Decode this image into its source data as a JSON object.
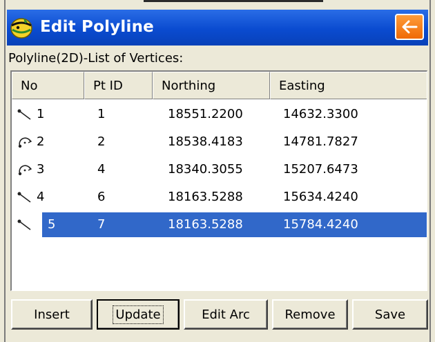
{
  "window": {
    "title": "Edit Polyline",
    "back_icon": "back-arrow-icon",
    "accent": "#0a4bd0",
    "back_color": "#ef6a05"
  },
  "list": {
    "caption": "Polyline(2D)-List of Vertices:",
    "columns": [
      "No",
      "Pt ID",
      "Northing",
      "Easting"
    ],
    "rows": [
      {
        "icon": "line-segment-icon",
        "no": "1",
        "pt_id": "1",
        "northing": "18551.2200",
        "easting": "14632.3300",
        "selected": false
      },
      {
        "icon": "arc-segment-icon",
        "no": "2",
        "pt_id": "2",
        "northing": "18538.4183",
        "easting": "14781.7827",
        "selected": false
      },
      {
        "icon": "arc-segment-icon",
        "no": "3",
        "pt_id": "4",
        "northing": "18340.3055",
        "easting": "15207.6473",
        "selected": false
      },
      {
        "icon": "line-segment-icon",
        "no": "4",
        "pt_id": "6",
        "northing": "18163.5288",
        "easting": "15634.4240",
        "selected": false
      },
      {
        "icon": "line-segment-icon",
        "no": "5",
        "pt_id": "7",
        "northing": "18163.5288",
        "easting": "15784.4240",
        "selected": true
      }
    ],
    "selection_color": "#3168c9"
  },
  "buttons": {
    "insert": "Insert",
    "update": "Update",
    "edit_arc": "Edit Arc",
    "remove": "Remove",
    "save": "Save"
  }
}
